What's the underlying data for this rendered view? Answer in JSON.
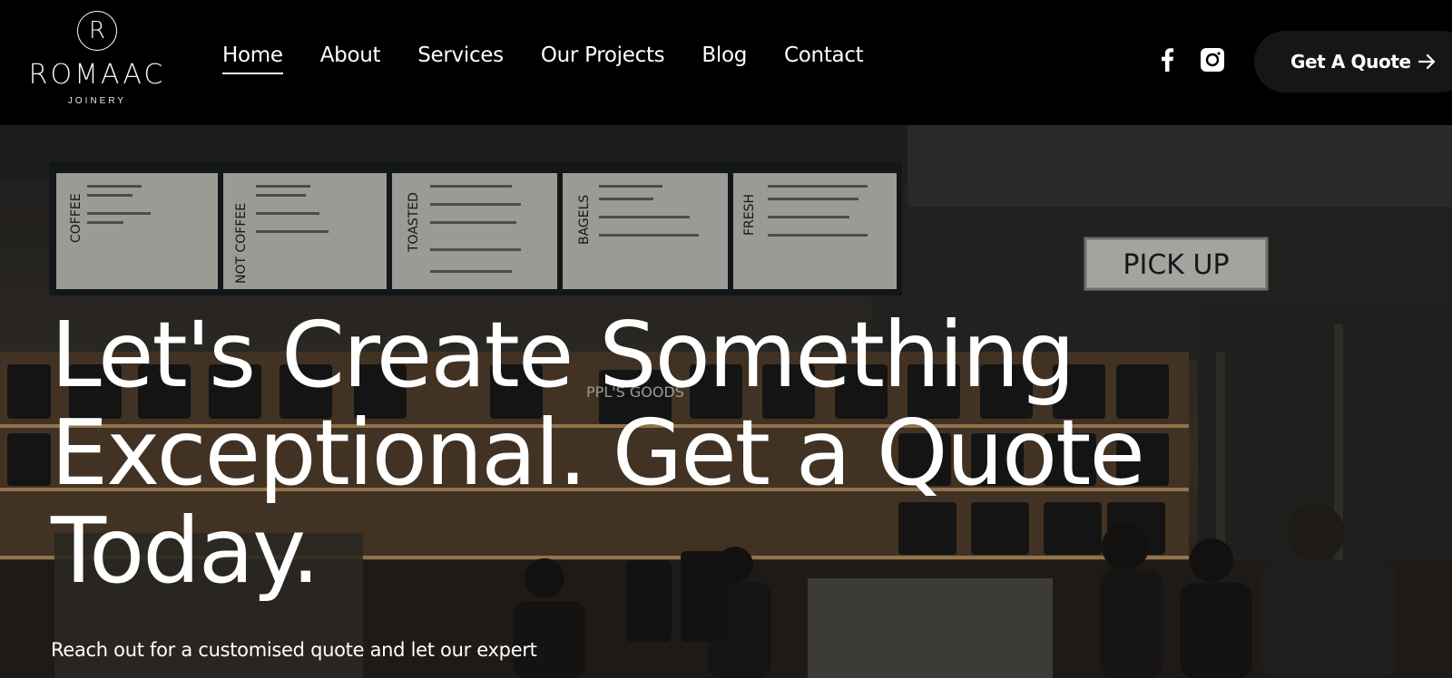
{
  "brand": {
    "mark": "R",
    "name": "ROMAAC",
    "tagline": "JOINERY"
  },
  "nav": {
    "items": [
      "Home",
      "About",
      "Services",
      "Our Projects",
      "Blog",
      "Contact"
    ],
    "active": "Home"
  },
  "social": {
    "facebook_icon": "facebook-icon",
    "instagram_icon": "instagram-icon"
  },
  "cta": {
    "label": "Get A Quote",
    "icon": "arrow-right-icon"
  },
  "hero": {
    "title": "Let's Create Something Exceptional. Get a Quote Today.",
    "subtitle": "Reach out for a customised quote and let our expert",
    "background": {
      "menu_boards": [
        "COFFEE",
        "NOT COFFEE",
        "TOASTED",
        "BAGELS",
        "FRESH"
      ],
      "sign": "PICK UP",
      "jar_label": "PPL'S",
      "goods_sign": "PPL'S GOODS"
    }
  },
  "colors": {
    "header_bg": "#000000",
    "cta_bg": "#161616",
    "text": "#ffffff"
  }
}
